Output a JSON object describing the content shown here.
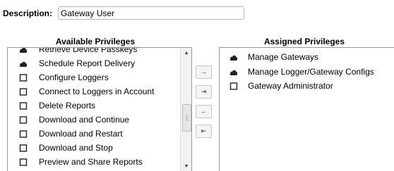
{
  "description": {
    "label": "Description:",
    "value": "Gateway User"
  },
  "available": {
    "title": "Available Privileges",
    "items": [
      {
        "label": "Retrieve Device Passkeys",
        "icon": "cloud-icon"
      },
      {
        "label": "Schedule Report Delivery",
        "icon": "cloud-icon"
      },
      {
        "label": "Configure Loggers",
        "icon": "checkbox-icon"
      },
      {
        "label": "Connect to Loggers in Account",
        "icon": "checkbox-icon"
      },
      {
        "label": "Delete Reports",
        "icon": "checkbox-icon"
      },
      {
        "label": "Download and Continue",
        "icon": "checkbox-icon"
      },
      {
        "label": "Download and Restart",
        "icon": "checkbox-icon"
      },
      {
        "label": "Download and Stop",
        "icon": "checkbox-icon"
      },
      {
        "label": "Preview and Share Reports",
        "icon": "checkbox-icon"
      }
    ]
  },
  "assigned": {
    "title": "Assigned Privileges",
    "items": [
      {
        "label": "Manage Gateways",
        "icon": "cloud-icon"
      },
      {
        "label": "Manage Logger/Gateway Configs",
        "icon": "cloud-icon"
      },
      {
        "label": "Gateway Administrator",
        "icon": "checkbox-icon"
      }
    ]
  },
  "move_buttons": {
    "add": "→",
    "add_all": "⇥",
    "remove": "←",
    "remove_all": "⇤"
  },
  "scrollbar": {
    "up": "▲",
    "down": "▼"
  }
}
